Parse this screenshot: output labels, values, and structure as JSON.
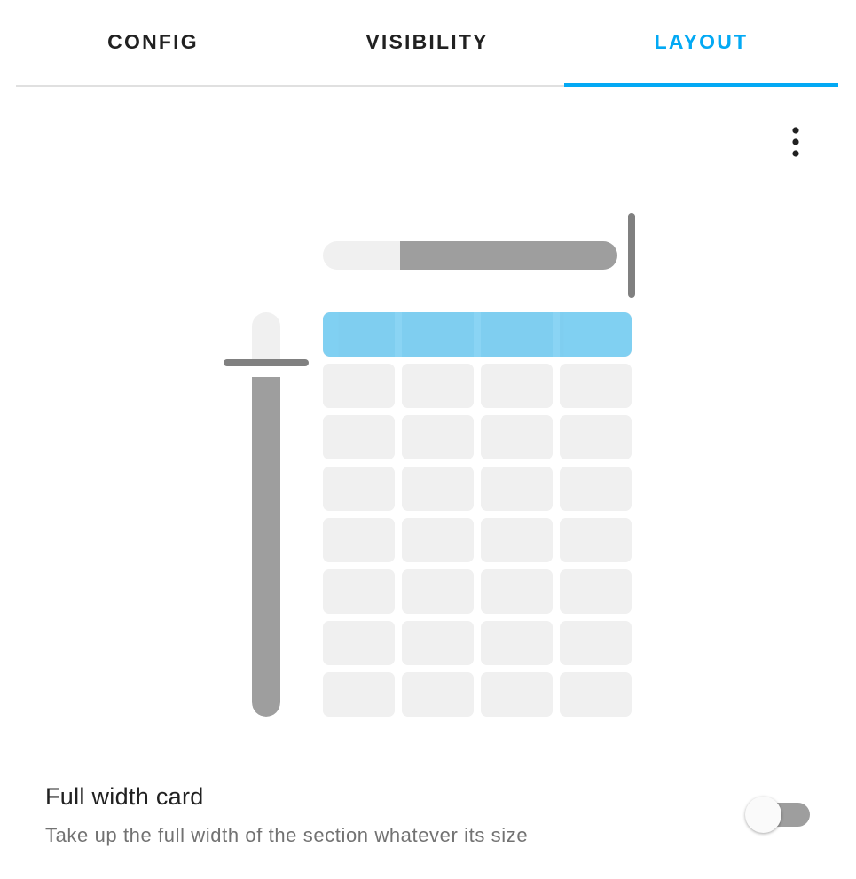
{
  "tabs": [
    {
      "label": "CONFIG",
      "active": false
    },
    {
      "label": "VISIBILITY",
      "active": false
    },
    {
      "label": "LAYOUT",
      "active": true
    }
  ],
  "icons": {
    "menu": "dots-vertical-icon"
  },
  "grid_editor": {
    "columns": 4,
    "rows": 8,
    "selected_columns": 4,
    "selected_rows": 1,
    "column_slider_value": 4,
    "row_slider_value": 1
  },
  "full_width_setting": {
    "title": "Full width card",
    "description": "Take up the full width of the section whatever its size",
    "enabled": false
  },
  "colors": {
    "accent": "#03a9f4",
    "selection": "#7bcdf2",
    "slider_fill": "#9e9e9e",
    "cell": "#f0f0f0"
  }
}
